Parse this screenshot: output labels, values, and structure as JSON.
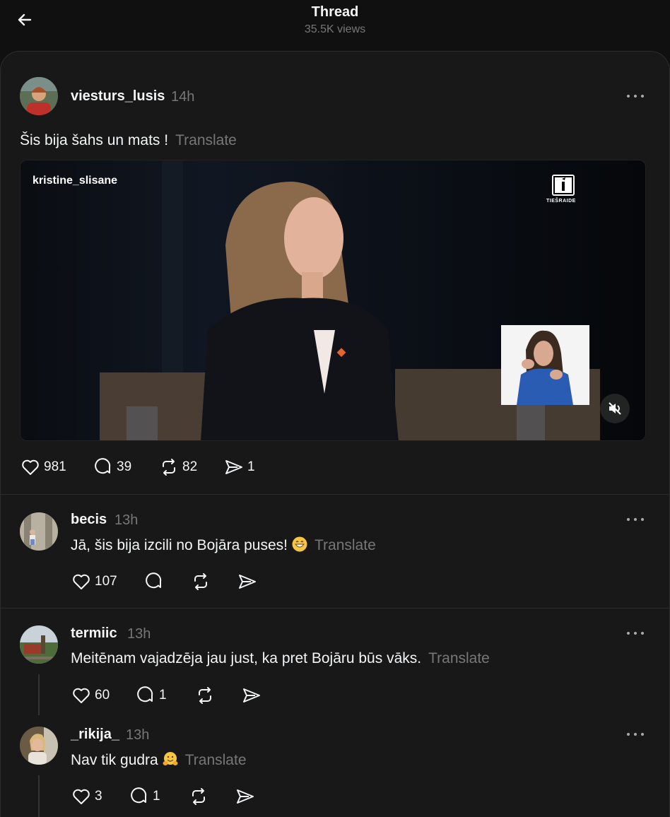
{
  "header": {
    "title": "Thread",
    "views": "35.5K views"
  },
  "post": {
    "username": "viesturs_lusis",
    "time": "14h",
    "text": "Šis bija šahs un mats !",
    "translate_label": "Translate",
    "media": {
      "overlay_username": "kristine_slisane",
      "logo_text": "TIEŠRAIDE"
    },
    "stats": {
      "likes": "981",
      "comments": "39",
      "reposts": "82",
      "shares": "1"
    }
  },
  "replies": [
    {
      "username": "becis",
      "time": "13h",
      "text": "Jā, šis bija izcili no Bojāra puses!",
      "emoji": "grinning-face-emoji",
      "translate_label": "Translate",
      "likes": "107",
      "comments": "",
      "reposts": "",
      "shares": ""
    },
    {
      "username": "termiic",
      "time": "13h",
      "text": "Meitēnam vajadzēja jau just, ka pret Bojāru būs vāks.",
      "emoji": "",
      "translate_label": "Translate",
      "likes": "60",
      "comments": "1",
      "reposts": "",
      "shares": ""
    },
    {
      "username": "_rikija_",
      "time": "13h",
      "text": "Nav tik gudra",
      "emoji": "hugging-face-emoji",
      "translate_label": "Translate",
      "likes": "3",
      "comments": "1",
      "reposts": "",
      "shares": ""
    }
  ],
  "colors": {
    "background": "#101010",
    "panel": "#181818",
    "text": "#f3f5f7",
    "muted": "#777777"
  }
}
